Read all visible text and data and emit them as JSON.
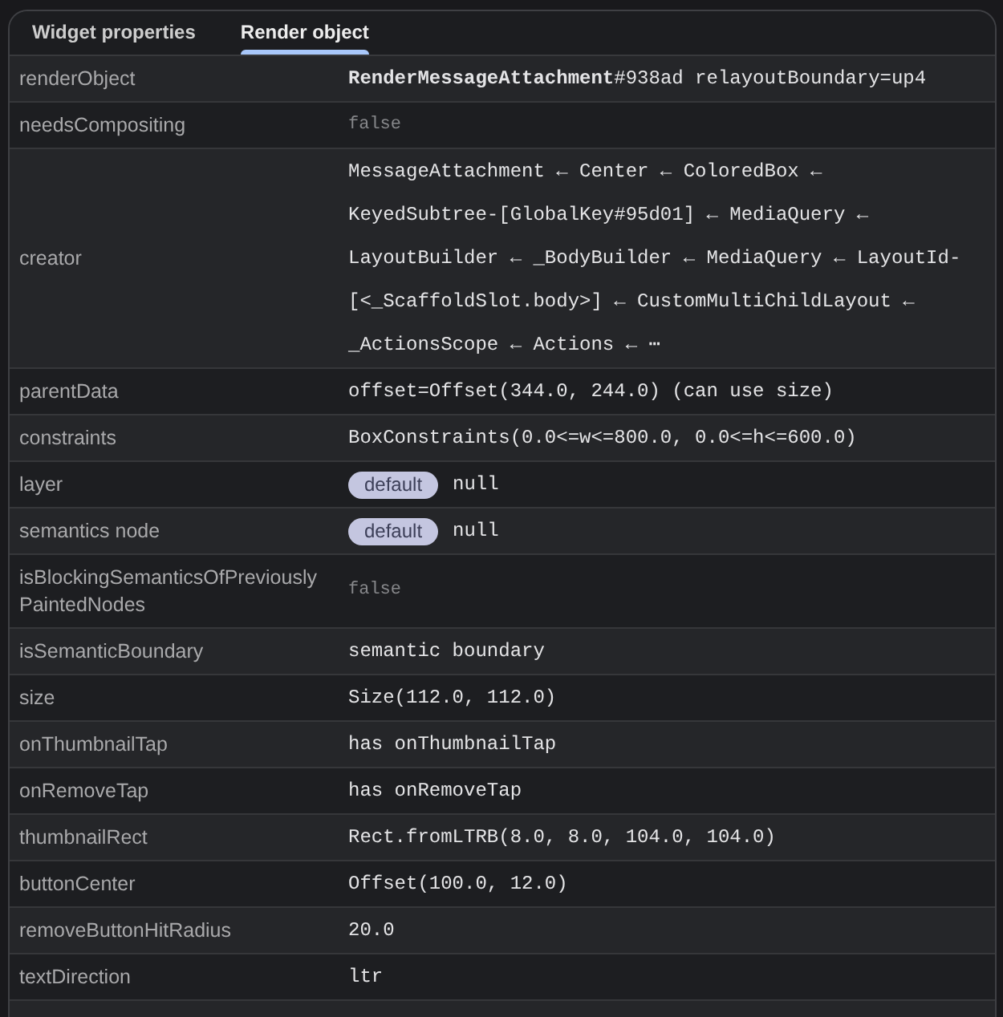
{
  "tabs": [
    {
      "label": "Widget properties",
      "selected": false
    },
    {
      "label": "Render object",
      "selected": true
    }
  ],
  "properties": [
    {
      "name": "renderObject",
      "value": "**RenderMessageAttachment**#938ad relayoutBoundary=up4",
      "dimmed": false
    },
    {
      "name": "needsCompositing",
      "value": "false",
      "dimmed": true
    },
    {
      "name": "creator",
      "value": "MessageAttachment ← Center ← ColoredBox ← KeyedSubtree-[GlobalKey#95d01] ← MediaQuery ← LayoutBuilder ← _BodyBuilder ← MediaQuery ← LayoutId-[<_ScaffoldSlot.body>] ← CustomMultiChildLayout ← _ActionsScope ← Actions ← ⋯",
      "dimmed": false
    },
    {
      "name": "parentData",
      "value": "offset=Offset(344.0, 244.0) (can use size)",
      "dimmed": false
    },
    {
      "name": "constraints",
      "value": "BoxConstraints(0.0<=w<=800.0, 0.0<=h<=600.0)",
      "dimmed": false
    },
    {
      "name": "layer",
      "badge": "default",
      "value": "null",
      "dimmed": false
    },
    {
      "name": "semantics node",
      "badge": "default",
      "value": "null",
      "dimmed": false
    },
    {
      "name": "isBlockingSemanticsOfPreviouslyPaintedNodes",
      "value": "false",
      "dimmed": true
    },
    {
      "name": "isSemanticBoundary",
      "value": "semantic boundary",
      "dimmed": false
    },
    {
      "name": "size",
      "value": "Size(112.0, 112.0)",
      "dimmed": false
    },
    {
      "name": "onThumbnailTap",
      "value": "has onThumbnailTap",
      "dimmed": false
    },
    {
      "name": "onRemoveTap",
      "value": "has onRemoveTap",
      "dimmed": false
    },
    {
      "name": "thumbnailRect",
      "value": "Rect.fromLTRB(8.0, 8.0, 104.0, 104.0)",
      "dimmed": false
    },
    {
      "name": "buttonCenter",
      "value": "Offset(100.0, 12.0)",
      "dimmed": false
    },
    {
      "name": "removeButtonHitRadius",
      "value": "20.0",
      "dimmed": false
    },
    {
      "name": "textDirection",
      "value": "ltr",
      "dimmed": false
    }
  ]
}
